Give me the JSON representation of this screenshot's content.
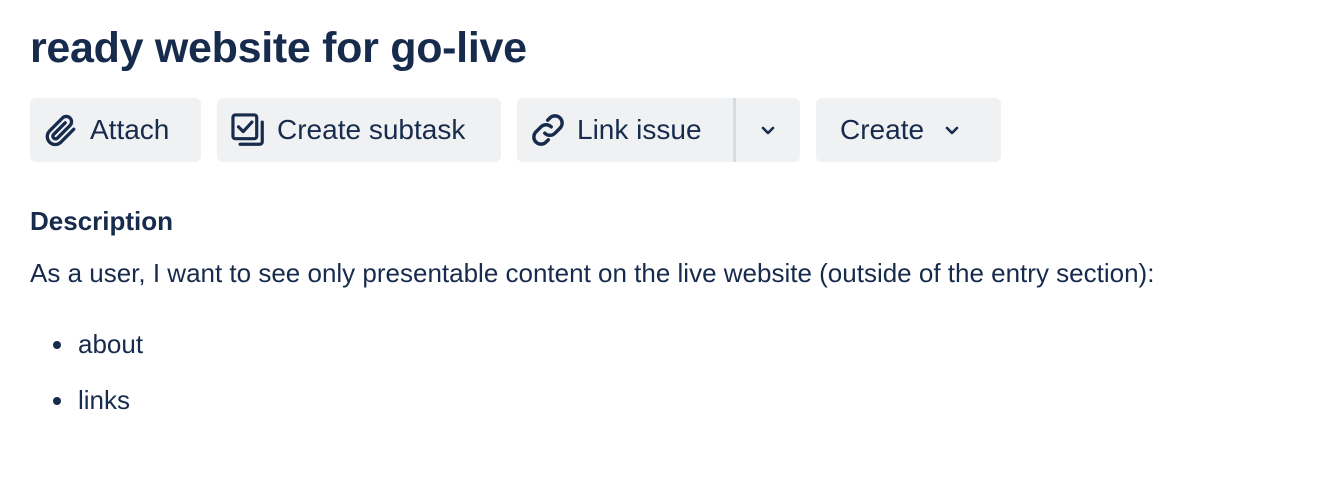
{
  "issue": {
    "title": "ready website for go-live"
  },
  "toolbar": {
    "attach_label": "Attach",
    "create_subtask_label": "Create subtask",
    "link_issue_label": "Link issue",
    "create_label": "Create",
    "icons": {
      "attach": "paperclip-icon",
      "create_subtask": "subtask-icon",
      "link_issue": "link-icon",
      "more": "chevron-down-icon"
    }
  },
  "description": {
    "heading": "Description",
    "text": "As a user, I want to see only presentable content on the live website (outside of the entry section):",
    "items": [
      "about",
      "links"
    ]
  },
  "colors": {
    "text": "#172b4d",
    "button_bg": "#f0f1f3"
  }
}
